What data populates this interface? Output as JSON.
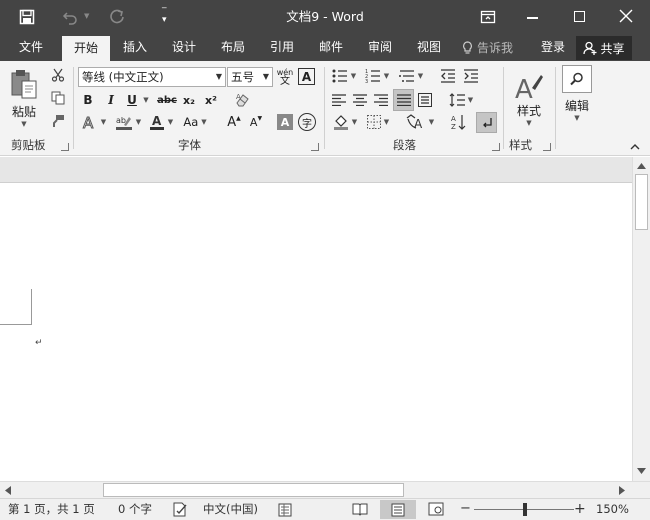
{
  "window": {
    "title": "文档9 - Word"
  },
  "menu": {
    "tabs": [
      "文件",
      "开始",
      "插入",
      "设计",
      "布局",
      "引用",
      "邮件",
      "审阅",
      "视图"
    ],
    "active_tab": "开始",
    "tell_me": "告诉我",
    "login": "登录",
    "share": "共享"
  },
  "clipboard": {
    "paste_label": "粘贴",
    "group_label": "剪贴板"
  },
  "font": {
    "font_name": "等线 (中文正文)",
    "font_size": "五号",
    "phonetic_top": "wén",
    "phonetic_bottom": "文",
    "border_char": "A",
    "bold": "B",
    "italic": "I",
    "underline": "U",
    "strike": "abc",
    "subscript": "x₂",
    "superscript": "x²",
    "change_case": "Aa",
    "grow": "A",
    "shrink": "A",
    "shading_char": "A",
    "enclose_char": "字",
    "group_label": "字体"
  },
  "paragraph": {
    "group_label": "段落"
  },
  "styles": {
    "label": "样式",
    "group_label": "样式"
  },
  "editing": {
    "label": "编辑"
  },
  "status": {
    "page": "第 1 页，共 1 页",
    "words": "0 个字",
    "language": "中文(中国)",
    "zoom": "150%"
  }
}
